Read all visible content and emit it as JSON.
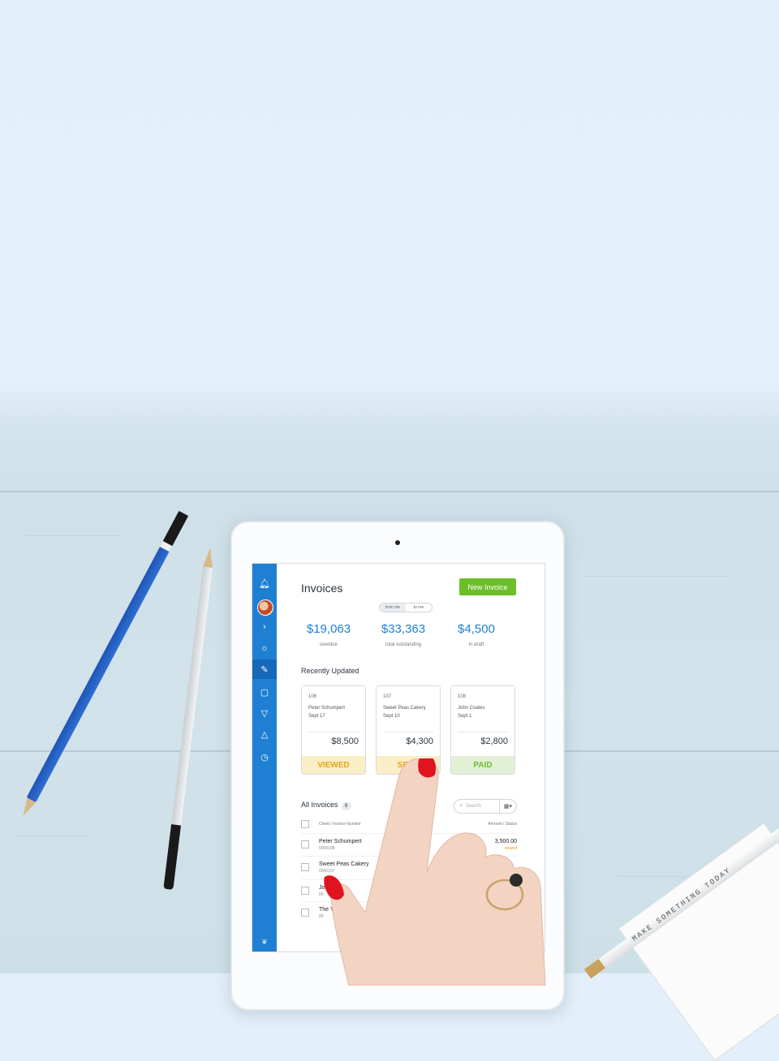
{
  "app": {
    "title": "Invoices",
    "new_invoice_label": "New Invoice",
    "toggle": {
      "from_me": "from me",
      "to_me": "to me"
    }
  },
  "summary": [
    {
      "amount": "$19,063",
      "label": "overdue"
    },
    {
      "amount": "$33,363",
      "label": "total outstanding"
    },
    {
      "amount": "$4,500",
      "label": "in draft"
    }
  ],
  "recently_updated": {
    "title": "Recently Updated",
    "cards": [
      {
        "number": "106",
        "client": "Peter Schumpert",
        "date": "Sept 17",
        "amount": "$8,500",
        "status": "VIEWED"
      },
      {
        "number": "107",
        "client": "Sweet Peas Cakery",
        "date": "Sept 10",
        "amount": "$4,300",
        "status": "SENT"
      },
      {
        "number": "108",
        "client": "John Coates",
        "date": "Sept 1",
        "amount": "$2,800",
        "status": "PAID"
      }
    ]
  },
  "all_invoices": {
    "title": "All Invoices",
    "count": "9",
    "search_placeholder": "Search",
    "columns": {
      "client": "Client / Invoice Number",
      "amount": "Amount / Status"
    },
    "rows": [
      {
        "client": "Peter Schumpert",
        "invoice": "0000108",
        "mid": "",
        "amount": "3,500.00",
        "status": "viewed"
      },
      {
        "client": "Sweet Peas Cakery",
        "invoice": "0000107",
        "mid": "6",
        "amount": "",
        "status": ""
      },
      {
        "client": "Jo",
        "invoice": "00",
        "mid": "6",
        "amount": "",
        "status": ""
      },
      {
        "client": "The Y",
        "invoice": "00",
        "mid": "",
        "amount": "",
        "status": ""
      }
    ]
  },
  "pencil_text": "MAKE SOMETHING TODAY",
  "colors": {
    "accent": "#1f7fd3",
    "new_button": "#6cbe2a",
    "viewed": "#e3a51a",
    "paid": "#6cbe2a"
  }
}
